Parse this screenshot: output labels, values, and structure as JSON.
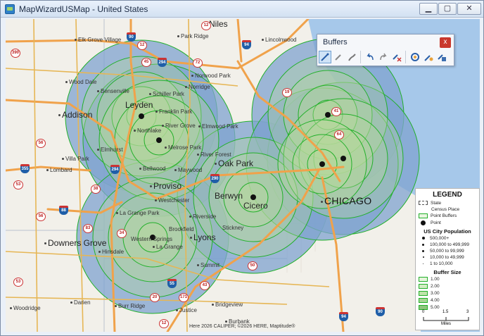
{
  "window": {
    "title": "MapWizardUSMap - United States",
    "controls": {
      "minimize": "▁",
      "maximize": "▢",
      "close": "✕"
    }
  },
  "colors": {
    "water": "#a6c8ea",
    "land": "#f2f0ea",
    "buffer_fill": "#a9cf8f",
    "buffer_outer": "#7fa3cf",
    "buffer_stroke": "#22b02a",
    "highway": "#f0a24b",
    "major_road": "#e4b24a",
    "county_line": "#b8c0cc"
  },
  "buffers_panel": {
    "title": "Buffers",
    "close": "x",
    "tools": [
      {
        "name": "draw-buffer-tool-icon",
        "active": true
      },
      {
        "name": "pencil-icon",
        "active": false
      },
      {
        "name": "brush-icon",
        "active": false
      },
      {
        "name": "undo-icon",
        "active": false
      },
      {
        "name": "redo-icon",
        "active": false
      },
      {
        "name": "clear-buffer-icon",
        "active": false
      },
      {
        "name": "buffer-settings-icon",
        "active": false
      },
      {
        "name": "edit-buffer-icon",
        "active": false
      },
      {
        "name": "save-buffer-icon",
        "active": false
      }
    ]
  },
  "places": {
    "niles": "Niles",
    "elk_grove": "Elk Grove Village",
    "park_ridge": "Park Ridge",
    "lincolnwood": "Lincolnwood",
    "wood_dale": "Wood Dale",
    "bensenville": "Bensenville",
    "schiller_park": "Schiller Park",
    "norwood_park": "Norwood Park",
    "norridge": "Norridge",
    "addison": "Addison",
    "leyden": "Leyden",
    "franklin_park": "Franklin Park",
    "northlake": "Northlake",
    "river_grove": "River Grove",
    "elmwood_park": "Elmwood Park",
    "melrose_park": "Melrose Park",
    "river_forest": "River Forest",
    "villa_park": "Villa Park",
    "elmhurst": "Elmhurst",
    "lombard": "Lombard",
    "bellwood": "Bellwood",
    "maywood": "Maywood",
    "oak_park": "Oak Park",
    "proviso": "Proviso",
    "westchester": "Westchester",
    "berwyn": "Berwyn",
    "cicero": "Cicero",
    "chicago": "CHICAGO",
    "la_grange_park": "La Grange Park",
    "riverside": "Riverside",
    "downers_grove": "Downers Grove",
    "brookfield": "Brookfield",
    "western_springs": "Western Springs",
    "la_grange": "La Grange",
    "lyons": "Lyons",
    "stickney": "Stickney",
    "hinsdale": "Hinsdale",
    "summit": "Summit",
    "woodridge": "Woodridge",
    "darien": "Darien",
    "burr_ridge": "Burr Ridge",
    "justice": "Justice",
    "bridgeview": "Bridgeview",
    "burbank": "Burbank"
  },
  "routes": {
    "r90": "90",
    "r12": "12",
    "r294": "294",
    "r94": "94",
    "r45": "45",
    "r72": "72",
    "r390": "390",
    "r19": "19",
    "r41": "41",
    "r64": "64",
    "r56": "56",
    "r53": "53",
    "r355": "355",
    "r38": "38",
    "r290": "290",
    "r88": "88",
    "r83": "83",
    "r34": "34",
    "r50": "50",
    "r55": "55",
    "r43": "43",
    "r171": "171",
    "r20": "20",
    "r90b": "90"
  },
  "copyright": "Here 2026 CALIPER; ©2026 HERE, Maptitude®",
  "legend": {
    "title": "LEGEND",
    "state": "State",
    "census_place": "Census Place",
    "point_buffers": "Point Buffers",
    "point": "Point",
    "population_title": "US City Population",
    "population": [
      "500,000+",
      "100,000 to 499,999",
      "50,000 to 99,999",
      "10,000 to 49,999",
      "1 to 10,000"
    ],
    "buffer_title": "Buffer Size",
    "buffer_sizes": [
      "1.00",
      "2.00",
      "3.00",
      "4.00",
      "5.00"
    ],
    "scale_ticks": [
      "0",
      "1.5",
      "3"
    ],
    "scale_unit": "Miles"
  }
}
